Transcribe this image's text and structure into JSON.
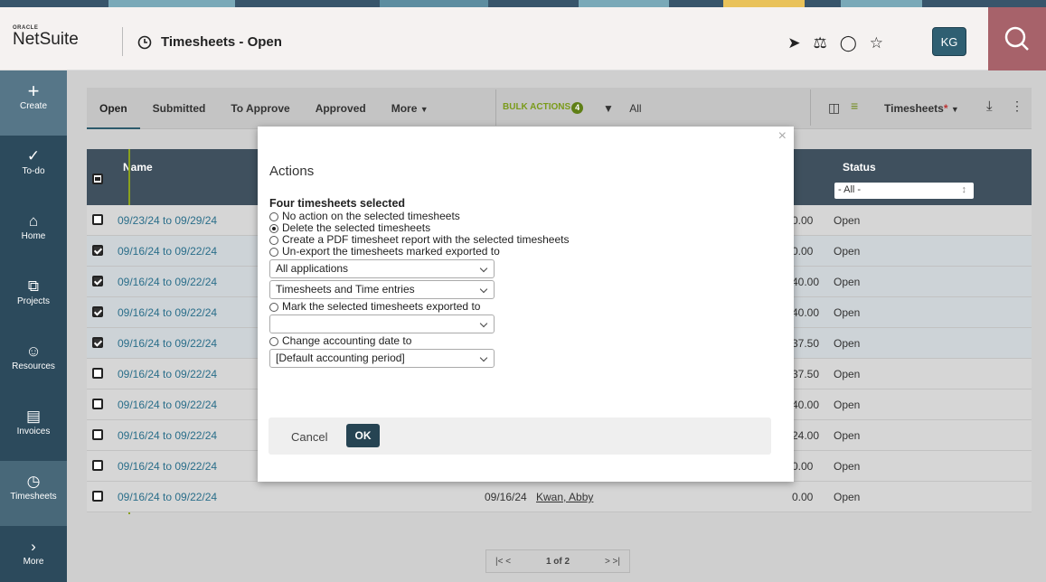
{
  "header": {
    "brand_top": "ORACLE",
    "brand_name": "NetSuite",
    "page_title": "Timesheets - Open",
    "avatar_initials": "KG"
  },
  "nav": {
    "items": [
      {
        "label": "Create",
        "icon": "plus-icon"
      },
      {
        "label": "To-do",
        "icon": "check-circle-icon"
      },
      {
        "label": "Home",
        "icon": "home-icon"
      },
      {
        "label": "Projects",
        "icon": "projects-icon"
      },
      {
        "label": "Resources",
        "icon": "people-icon"
      },
      {
        "label": "Invoices",
        "icon": "invoice-icon"
      },
      {
        "label": "Timesheets",
        "icon": "clock-icon"
      },
      {
        "label": "More",
        "icon": "chevron-right-icon"
      }
    ]
  },
  "toolbar": {
    "tabs": [
      "Open",
      "Submitted",
      "To Approve",
      "Approved",
      "More"
    ],
    "bulk_actions": "BULK ACTIONS",
    "bulk_count": "4",
    "filter_value": "All",
    "view_label": "Timesheets"
  },
  "table": {
    "columns": {
      "name": "Name",
      "status": "Status"
    },
    "status_filter": "- All -",
    "rows": [
      {
        "name": "09/23/24 to 09/29/24",
        "amount": "0.00",
        "status": "Open",
        "checked": false
      },
      {
        "name": "09/16/24 to 09/22/24",
        "amount": "0.00",
        "status": "Open",
        "checked": true
      },
      {
        "name": "09/16/24 to 09/22/24",
        "amount": "40.00",
        "status": "Open",
        "checked": true
      },
      {
        "name": "09/16/24 to 09/22/24",
        "amount": "40.00",
        "status": "Open",
        "checked": true
      },
      {
        "name": "09/16/24 to 09/22/24",
        "amount": "37.50",
        "status": "Open",
        "checked": true
      },
      {
        "name": "09/16/24 to 09/22/24",
        "amount": "37.50",
        "status": "Open",
        "checked": false
      },
      {
        "name": "09/16/24 to 09/22/24",
        "amount": "40.00",
        "status": "Open",
        "checked": false
      },
      {
        "name": "09/16/24 to 09/22/24",
        "amount": "24.00",
        "status": "Open",
        "checked": false
      },
      {
        "name": "09/16/24 to 09/22/24",
        "amount": "0.00",
        "status": "Open",
        "checked": false
      },
      {
        "name": "09/16/24 to 09/22/24",
        "date": "09/16/24",
        "employee": "Kwan, Abby",
        "amount": "0.00",
        "status": "Open",
        "checked": false
      }
    ]
  },
  "pager": {
    "text": "1 of 2"
  },
  "modal": {
    "title": "Actions",
    "subtitle": "Four timesheets selected",
    "options": [
      "No action on the selected timesheets",
      "Delete the selected timesheets",
      "Create a PDF timesheet report with the selected timesheets",
      "Un-export the timesheets marked exported to",
      "Mark the selected timesheets exported to",
      "Change accounting date to"
    ],
    "selected_option": 1,
    "select_applications": "All applications",
    "select_entries": "Timesheets and Time entries",
    "select_export_target": "",
    "select_period": "[Default accounting period]",
    "cancel": "Cancel",
    "ok": "OK"
  }
}
